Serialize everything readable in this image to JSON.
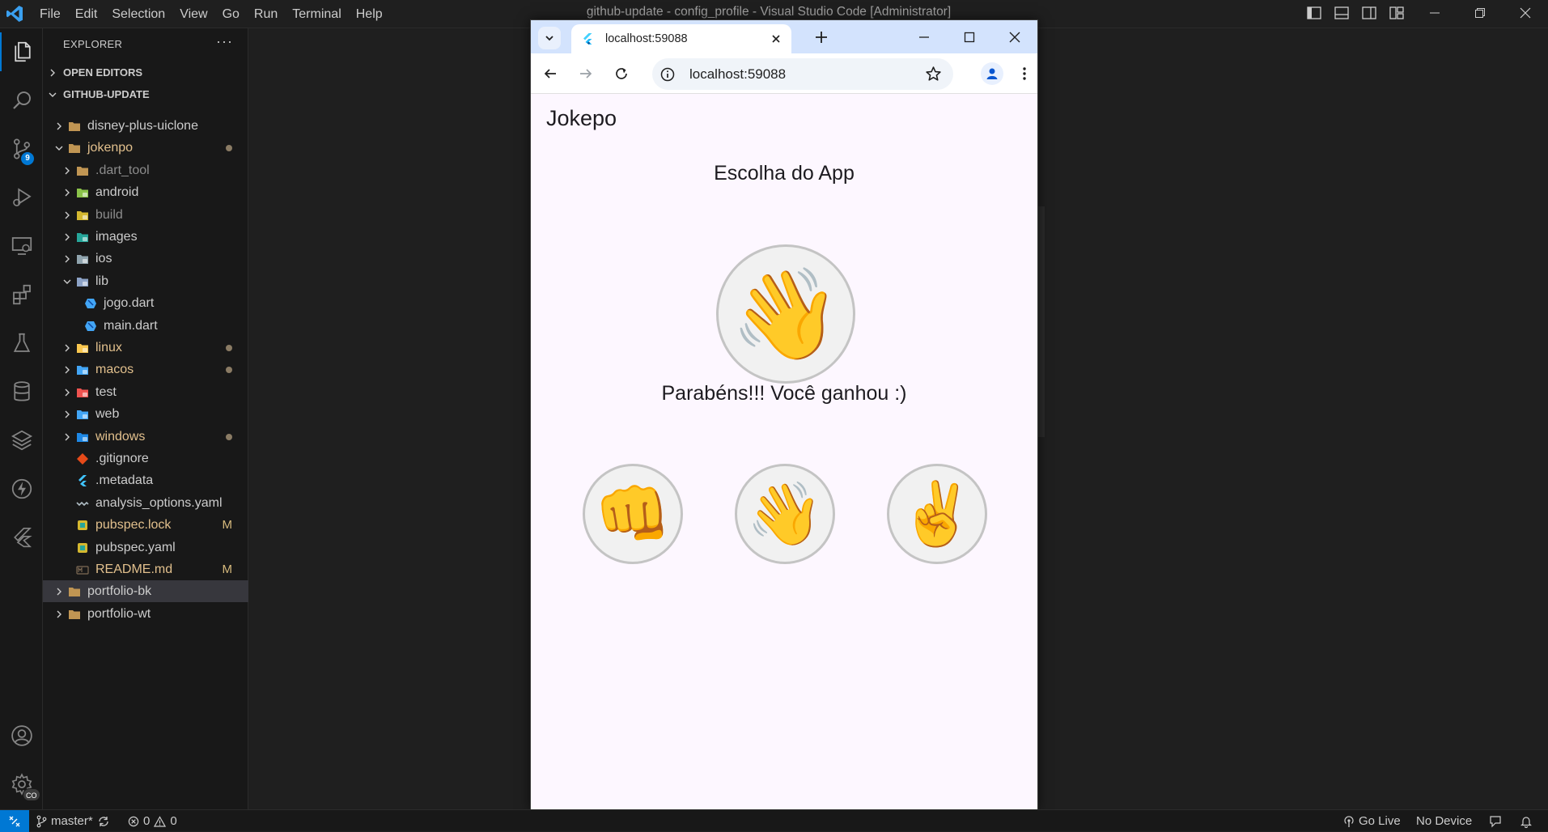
{
  "titlebar": {
    "menu": [
      "File",
      "Edit",
      "Selection",
      "View",
      "Go",
      "Run",
      "Terminal",
      "Help"
    ],
    "window_title": "github-update - config_profile - Visual Studio Code [Administrator]"
  },
  "activitybar": {
    "source_control_badge": "9",
    "manage_badge": "CO"
  },
  "sidebar": {
    "title": "EXPLORER",
    "more": "···",
    "open_editors": "OPEN EDITORS",
    "workspace": "GITHUB-UPDATE",
    "items": [
      {
        "name": "disney-plus-uiclone",
        "depth": 0,
        "type": "folder",
        "open": false,
        "color": "norm",
        "icon": "folder-icon"
      },
      {
        "name": "jokenpo",
        "depth": 0,
        "type": "folder",
        "open": true,
        "color": "mod",
        "dot": true,
        "icon": "folder-icon"
      },
      {
        "name": ".dart_tool",
        "depth": 1,
        "type": "folder",
        "open": false,
        "color": "dim",
        "icon": "folder-icon"
      },
      {
        "name": "android",
        "depth": 1,
        "type": "folder",
        "open": false,
        "color": "norm",
        "icon": "android-folder-icon"
      },
      {
        "name": "build",
        "depth": 1,
        "type": "folder",
        "open": false,
        "color": "dim",
        "icon": "build-folder-icon"
      },
      {
        "name": "images",
        "depth": 1,
        "type": "folder",
        "open": false,
        "color": "norm",
        "icon": "images-folder-icon"
      },
      {
        "name": "ios",
        "depth": 1,
        "type": "folder",
        "open": false,
        "color": "norm",
        "icon": "ios-folder-icon"
      },
      {
        "name": "lib",
        "depth": 1,
        "type": "folder",
        "open": true,
        "color": "norm",
        "icon": "lib-folder-icon"
      },
      {
        "name": "jogo.dart",
        "depth": 2,
        "type": "file",
        "color": "norm",
        "icon": "dart-file-icon"
      },
      {
        "name": "main.dart",
        "depth": 2,
        "type": "file",
        "color": "norm",
        "icon": "dart-file-icon"
      },
      {
        "name": "linux",
        "depth": 1,
        "type": "folder",
        "open": false,
        "color": "mod",
        "dot": true,
        "icon": "linux-folder-icon"
      },
      {
        "name": "macos",
        "depth": 1,
        "type": "folder",
        "open": false,
        "color": "mod",
        "dot": true,
        "icon": "macos-folder-icon"
      },
      {
        "name": "test",
        "depth": 1,
        "type": "folder",
        "open": false,
        "color": "norm",
        "icon": "test-folder-icon"
      },
      {
        "name": "web",
        "depth": 1,
        "type": "folder",
        "open": false,
        "color": "norm",
        "icon": "web-folder-icon"
      },
      {
        "name": "windows",
        "depth": 1,
        "type": "folder",
        "open": false,
        "color": "mod",
        "dot": true,
        "icon": "windows-folder-icon"
      },
      {
        "name": ".gitignore",
        "depth": 1,
        "type": "file",
        "color": "norm",
        "icon": "git-file-icon"
      },
      {
        "name": ".metadata",
        "depth": 1,
        "type": "file",
        "color": "norm",
        "icon": "flutter-file-icon"
      },
      {
        "name": "analysis_options.yaml",
        "depth": 1,
        "type": "file",
        "color": "norm",
        "icon": "yaml-file-icon"
      },
      {
        "name": "pubspec.lock",
        "depth": 1,
        "type": "file",
        "color": "mod",
        "badge": "M",
        "icon": "lock-file-icon"
      },
      {
        "name": "pubspec.yaml",
        "depth": 1,
        "type": "file",
        "color": "norm",
        "icon": "pubspec-file-icon"
      },
      {
        "name": "README.md",
        "depth": 1,
        "type": "file",
        "color": "mod",
        "badge": "M",
        "icon": "markdown-file-icon"
      },
      {
        "name": "portfolio-bk",
        "depth": 0,
        "type": "folder",
        "open": false,
        "color": "norm",
        "selected": true,
        "icon": "folder-icon"
      },
      {
        "name": "portfolio-wt",
        "depth": 0,
        "type": "folder",
        "open": false,
        "color": "norm",
        "icon": "folder-icon"
      }
    ]
  },
  "statusbar": {
    "branch": "master*",
    "errors": "0",
    "warnings": "0",
    "go_live": "Go Live",
    "device": "No Device"
  },
  "browser": {
    "tab_title": "localhost:59088",
    "url": "localhost:59088"
  },
  "app": {
    "title": "Jokepo",
    "choice_label": "Escolha do App",
    "app_choice_emoji": "👋",
    "result": "Parabéns!!! Você ganhou :)",
    "options": [
      {
        "name": "pedra",
        "emoji": "👊"
      },
      {
        "name": "papel",
        "emoji": "👋"
      },
      {
        "name": "tesoura",
        "emoji": "✌️"
      }
    ]
  },
  "colors": {
    "vscode_accent": "#0078d4",
    "modified_text": "#e2c08d",
    "browser_tabstrip": "#d3e3fd",
    "app_background": "#fdf7ff"
  }
}
